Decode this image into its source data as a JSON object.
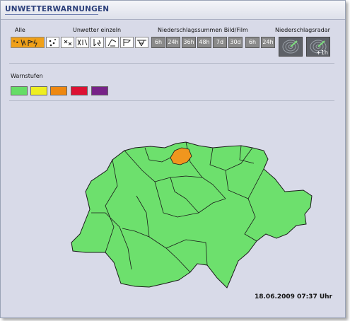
{
  "header": {
    "title": "UNWETTERWARNUNGEN"
  },
  "filters": {
    "all_label": "Alle",
    "single_label": "Unwetter einzeln",
    "precip_label": "Niederschlagssummen Bild/Film",
    "radar_label": "Niederschlagsradar",
    "precip_buttons": [
      "6h",
      "24h",
      "36h",
      "48h",
      "7d",
      "30d"
    ],
    "radar_hour_buttons": [
      "6h",
      "24h"
    ],
    "radar_plus_label": "+1h"
  },
  "levels": {
    "label": "Warnstufen",
    "colors": [
      "#66dd66",
      "#eeee22",
      "#ee8811",
      "#dd1133",
      "#772288"
    ]
  },
  "map": {
    "fill_color": "#6de06d",
    "warning_color": "#f0961e",
    "border_color": "#1a1a1a"
  },
  "footer": {
    "timestamp": "18.06.2009 07:37 Uhr"
  }
}
